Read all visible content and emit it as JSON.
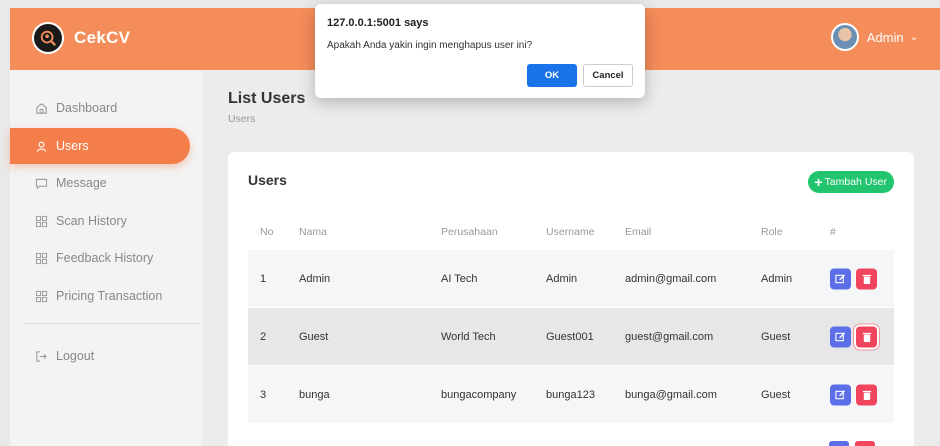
{
  "brand": {
    "name": "CekCV"
  },
  "user_menu": {
    "name": "Admin"
  },
  "sidebar": {
    "items": [
      {
        "label": "Dashboard",
        "icon": "home-icon"
      },
      {
        "label": "Users",
        "icon": "user-icon",
        "active": true
      },
      {
        "label": "Message",
        "icon": "message-icon"
      },
      {
        "label": "Scan History",
        "icon": "grid-icon"
      },
      {
        "label": "Feedback History",
        "icon": "grid-icon"
      },
      {
        "label": "Pricing Transaction",
        "icon": "grid-icon"
      },
      {
        "label": "Logout",
        "icon": "logout-icon"
      }
    ]
  },
  "page": {
    "title": "List Users",
    "breadcrumb": "Users"
  },
  "card": {
    "title": "Users",
    "add_button": "Tambah User"
  },
  "table": {
    "columns": [
      "No",
      "Nama",
      "Perusahaan",
      "Username",
      "Email",
      "Role",
      "#"
    ],
    "rows": [
      {
        "no": "1",
        "nama": "Admin",
        "perusahaan": "AI Tech",
        "username": "Admin",
        "email": "admin@gmail.com",
        "role": "Admin"
      },
      {
        "no": "2",
        "nama": "Guest",
        "perusahaan": "World Tech",
        "username": "Guest001",
        "email": "guest@gmail.com",
        "role": "Guest"
      },
      {
        "no": "3",
        "nama": "bunga",
        "perusahaan": "bungacompany",
        "username": "bunga123",
        "email": "bunga@gmail.com",
        "role": "Guest"
      }
    ]
  },
  "dialog": {
    "title": "127.0.0.1:5001 says",
    "message": "Apakah Anda yakin ingin menghapus user ini?",
    "ok": "OK",
    "cancel": "Cancel"
  },
  "colors": {
    "accent": "#f58d5a",
    "success": "#22c46e",
    "edit": "#5b6ee8",
    "delete": "#f0455c",
    "dialog_ok": "#1a73e8"
  }
}
